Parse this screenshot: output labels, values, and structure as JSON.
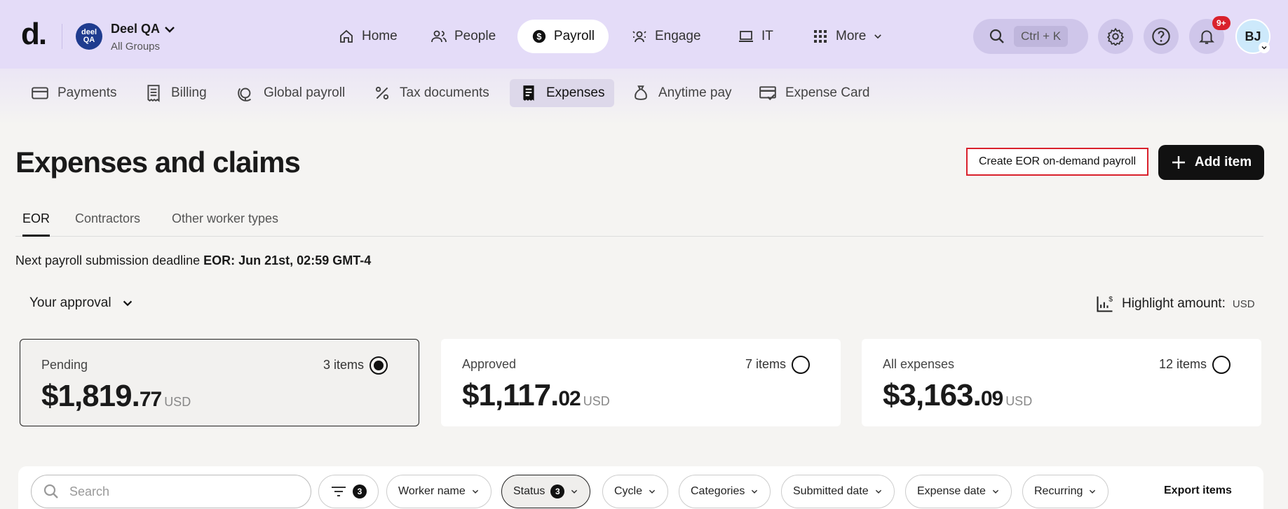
{
  "brand": {
    "logo": "d.",
    "org_avatar_text": "deel QA",
    "org_name": "Deel QA",
    "org_sub": "All Groups"
  },
  "topnav": {
    "items": [
      {
        "label": "Home",
        "icon": "home-icon"
      },
      {
        "label": "People",
        "icon": "people-icon"
      },
      {
        "label": "Payroll",
        "icon": "dollar-icon",
        "active": true
      },
      {
        "label": "Engage",
        "icon": "engage-icon"
      },
      {
        "label": "IT",
        "icon": "laptop-icon"
      },
      {
        "label": "More",
        "icon": "grid-icon"
      }
    ],
    "search_shortcut": "Ctrl + K",
    "notifications_badge": "9+",
    "user_initials": "BJ"
  },
  "subnav": {
    "items": [
      {
        "label": "Payments"
      },
      {
        "label": "Billing"
      },
      {
        "label": "Global payroll"
      },
      {
        "label": "Tax documents"
      },
      {
        "label": "Expenses",
        "active": true
      },
      {
        "label": "Anytime pay"
      },
      {
        "label": "Expense Card"
      }
    ]
  },
  "page": {
    "title": "Expenses and claims",
    "create_button": "Create EOR on-demand payroll",
    "add_button": "Add item",
    "tabs": [
      "EOR",
      "Contractors",
      "Other worker types"
    ],
    "deadline_prefix": "Next payroll submission deadline ",
    "deadline_value": "EOR: Jun 21st, 02:59 GMT-4",
    "approval_filter": "Your approval",
    "highlight_label": "Highlight amount:",
    "highlight_currency": "USD"
  },
  "cards": [
    {
      "label": "Pending",
      "count": "3 items",
      "amount": "$1,819.",
      "cents": "77",
      "currency": "USD",
      "selected": true
    },
    {
      "label": "Approved",
      "count": "7 items",
      "amount": "$1,117.",
      "cents": "02",
      "currency": "USD",
      "selected": false
    },
    {
      "label": "All expenses",
      "count": "12 items",
      "amount": "$3,163.",
      "cents": "09",
      "currency": "USD",
      "selected": false
    }
  ],
  "filters": {
    "search_placeholder": "Search",
    "filter_count": "3",
    "chips": [
      "Worker name",
      "Status",
      "Cycle",
      "Categories",
      "Submitted date",
      "Expense date",
      "Recurring"
    ],
    "status_count": "3",
    "export": "Export items"
  },
  "colors": {
    "topbar": "#e4dcf8",
    "accent_red": "#d9212c",
    "dark": "#111111"
  }
}
